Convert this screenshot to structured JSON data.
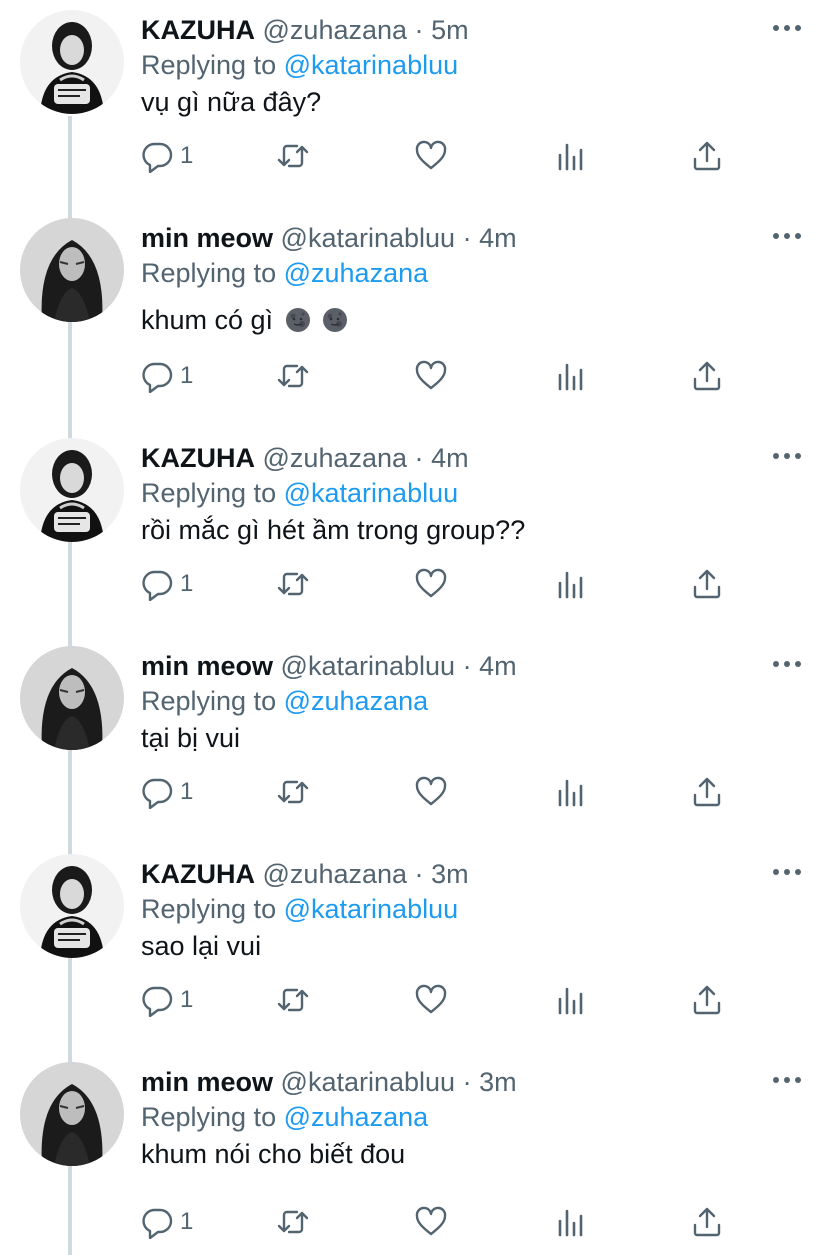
{
  "tweets": [
    {
      "author": "KAZUHA",
      "handle": "@zuhazana",
      "dot": "·",
      "time": "5m",
      "replying_prefix": "Replying to",
      "replying_to": "@katarinabluu",
      "text": "vụ gì nữa đây?",
      "reply_count": "1",
      "avatar": "kazuha-avatar"
    },
    {
      "author": "min meow",
      "handle": "@katarinabluu",
      "dot": "·",
      "time": "4m",
      "replying_prefix": "Replying to",
      "replying_to": "@zuhazana",
      "text": "khum có gì",
      "emojis": [
        "new-moon-face-emoji",
        "new-moon-face-emoji"
      ],
      "reply_count": "1",
      "avatar": "min-meow-avatar"
    },
    {
      "author": "KAZUHA",
      "handle": "@zuhazana",
      "dot": "·",
      "time": "4m",
      "replying_prefix": "Replying to",
      "replying_to": "@katarinabluu",
      "text": "rồi mắc gì hét ầm trong group??",
      "reply_count": "1",
      "avatar": "kazuha-avatar"
    },
    {
      "author": "min meow",
      "handle": "@katarinabluu",
      "dot": "·",
      "time": "4m",
      "replying_prefix": "Replying to",
      "replying_to": "@zuhazana",
      "text": "tại bị vui",
      "reply_count": "1",
      "avatar": "min-meow-avatar"
    },
    {
      "author": "KAZUHA",
      "handle": "@zuhazana",
      "dot": "·",
      "time": "3m",
      "replying_prefix": "Replying to",
      "replying_to": "@katarinabluu",
      "text": "sao lại vui",
      "reply_count": "1",
      "avatar": "kazuha-avatar"
    },
    {
      "author": "min meow",
      "handle": "@katarinabluu",
      "dot": "·",
      "time": "3m",
      "replying_prefix": "Replying to",
      "replying_to": "@zuhazana",
      "text": "khum nói cho biết đou",
      "reply_count": "1",
      "avatar": "min-meow-avatar"
    }
  ],
  "icons": {
    "more": "more-horizontal-icon",
    "reply": "reply-bubble-icon",
    "retweet": "retweet-icon",
    "like": "heart-icon",
    "stats": "analytics-bars-icon",
    "share": "share-upload-icon"
  },
  "colors": {
    "text": "#0f1419",
    "secondary": "#536471",
    "mention": "#1d9bf0",
    "thread_line": "#cfd9de"
  }
}
